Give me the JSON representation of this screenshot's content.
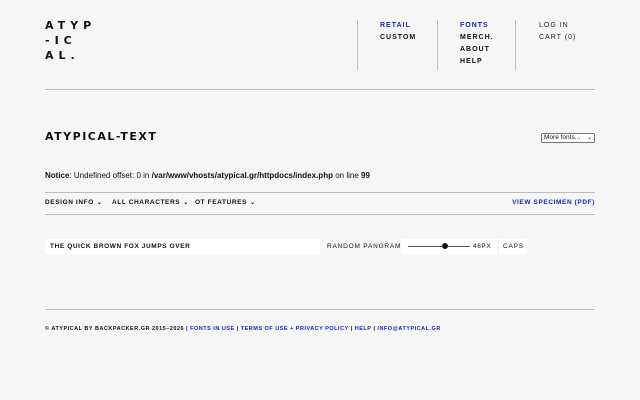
{
  "logo": {
    "lines": [
      "ATYP",
      "-IC",
      "AL."
    ]
  },
  "nav": {
    "col1": [
      {
        "label": "RETAIL",
        "active": true
      },
      {
        "label": "CUSTOM",
        "active": false
      }
    ],
    "col2": [
      {
        "label": "FONTS",
        "active": true
      },
      {
        "label": "MERCH.",
        "active": false
      },
      {
        "label": "ABOUT",
        "active": false
      },
      {
        "label": "HELP",
        "active": false
      }
    ],
    "col3": [
      {
        "label": "LOG IN"
      },
      {
        "label": "CART (0)"
      }
    ]
  },
  "page": {
    "title": "ATYPICAL-TEXT",
    "select_value": "More fonts...",
    "notice_label": "Notice",
    "notice_text": ": Undefined offset: 0 in ",
    "notice_path": "/var/www/vhosts/atypical.gr/httpdocs/index.php",
    "notice_on": " on line ",
    "notice_line": "99"
  },
  "toolbar": {
    "design_info": "DESIGN INFO",
    "all_characters": "ALL CHARACTERS",
    "ot_features": "OT FEATURES",
    "view_specimen": "VIEW SPECIMEN (PDF)"
  },
  "tester": {
    "sample_text": "THE QUICK BROWN FOX JUMPS OVER",
    "pangram_label": "RANDOM PANGRAM",
    "size_label": "48PX",
    "size_value": 48,
    "size_fraction": 0.6,
    "caps_label": "CAPS"
  },
  "footer": {
    "copyright": "© ATYPICAL BY BACKPACKER.GR 2015–2026",
    "sep": " | ",
    "fonts_in_use": "FONTS IN USE",
    "terms": "TERMS OF USE + PRIVACY POLICY",
    "help": "HELP",
    "email": "INFO@ATYPICAL.GR"
  },
  "colors": {
    "accent": "#1d22b3",
    "background": "#f6f6f6",
    "rule": "#bdbdbd"
  }
}
